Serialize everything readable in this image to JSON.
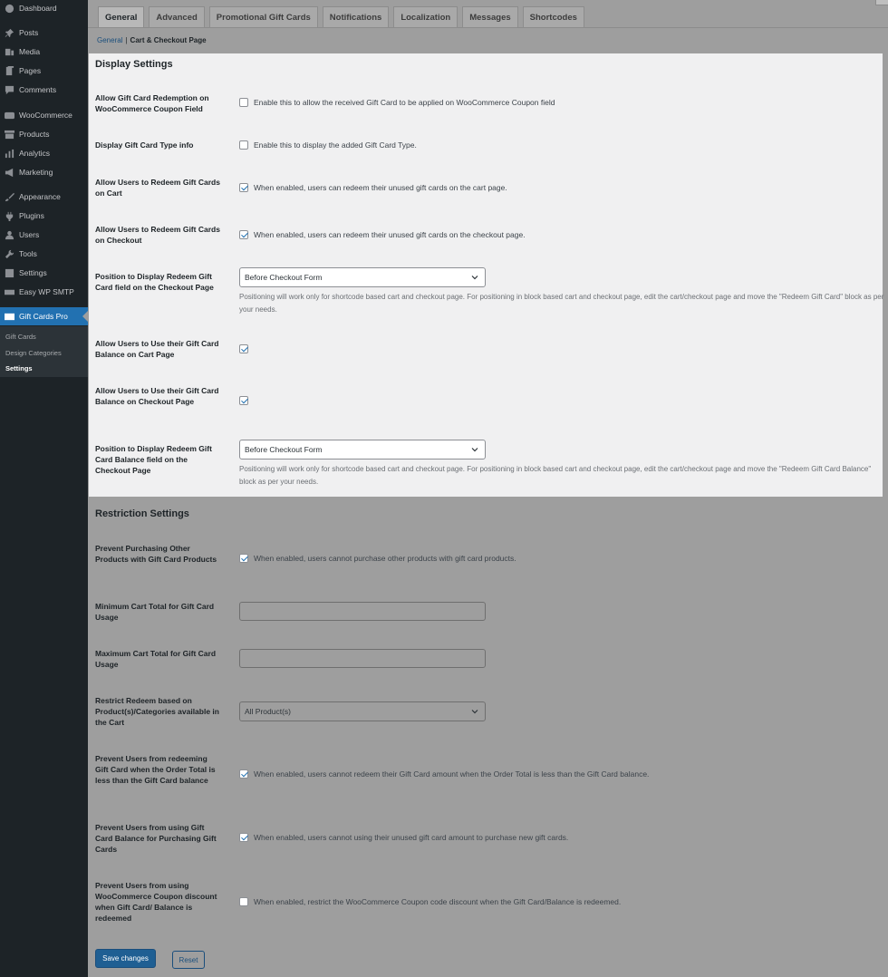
{
  "sidebar": {
    "menu": [
      {
        "label": "Dashboard",
        "icon": "dashboard-icon"
      },
      {
        "label": "Posts",
        "icon": "pin-icon"
      },
      {
        "label": "Media",
        "icon": "media-icon"
      },
      {
        "label": "Pages",
        "icon": "pages-icon"
      },
      {
        "label": "Comments",
        "icon": "comment-icon"
      },
      {
        "label": "WooCommerce",
        "icon": "woo-icon"
      },
      {
        "label": "Products",
        "icon": "archive-icon"
      },
      {
        "label": "Analytics",
        "icon": "bar-chart-icon"
      },
      {
        "label": "Marketing",
        "icon": "megaphone-icon"
      },
      {
        "label": "Appearance",
        "icon": "brush-icon"
      },
      {
        "label": "Plugins",
        "icon": "plug-icon"
      },
      {
        "label": "Users",
        "icon": "user-icon"
      },
      {
        "label": "Tools",
        "icon": "wrench-icon"
      },
      {
        "label": "Settings",
        "icon": "sliders-icon"
      },
      {
        "label": "Easy WP SMTP",
        "icon": "mail-icon"
      },
      {
        "label": "Gift Cards Pro",
        "icon": "gift-card-icon"
      }
    ],
    "submenu": [
      "Gift Cards",
      "Design Categories",
      "Settings"
    ]
  },
  "tabs": [
    "General",
    "Advanced",
    "Promotional Gift Cards",
    "Notifications",
    "Localization",
    "Messages",
    "Shortcodes"
  ],
  "breadcrumb": {
    "parent": "General",
    "current": "Cart & Checkout Page"
  },
  "display": {
    "title": "Display Settings",
    "rows": [
      {
        "label": "Allow Gift Card Redemption on WooCommerce Coupon Field",
        "desc": "Enable this to allow the received Gift Card to be applied on WooCommerce Coupon field",
        "checked": false
      },
      {
        "label": "Display Gift Card Type info",
        "desc": "Enable this to display the added Gift Card Type.",
        "checked": false
      },
      {
        "label": "Allow Users to Redeem Gift Cards on Cart",
        "desc": "When enabled, users can redeem their unused gift cards on the cart page.",
        "checked": true
      },
      {
        "label": "Allow Users to Redeem Gift Cards on Checkout",
        "desc": "When enabled, users can redeem their unused gift cards on the checkout page.",
        "checked": true
      },
      {
        "label": "Position to Display Redeem Gift Card field on the Checkout Page",
        "select": "Before Checkout Form",
        "help": "Positioning will work only for shortcode based cart and checkout page. For positioning in block based cart and checkout page, edit the cart/checkout page and move the \"Redeem Gift Card\" block as per your needs."
      },
      {
        "label": "Allow Users to Use their Gift Card Balance on Cart Page",
        "checked": true
      },
      {
        "label": "Allow Users to Use their Gift Card Balance on Checkout Page",
        "checked": true
      },
      {
        "label": "Position to Display Redeem Gift Card Balance field on the Checkout Page",
        "select": "Before Checkout Form",
        "help": "Positioning will work only for shortcode based cart and checkout page. For positioning in block based cart and checkout page, edit the cart/checkout page and move the \"Redeem Gift Card Balance\" block as per your needs."
      }
    ]
  },
  "restriction": {
    "title": "Restriction Settings",
    "rows": [
      {
        "label": "Prevent Purchasing Other Products with Gift Card Products",
        "desc": "When enabled, users cannot purchase other products with gift card products.",
        "checked": true
      },
      {
        "label": "Minimum Cart Total for Gift Card Usage",
        "value": ""
      },
      {
        "label": "Maximum Cart Total for Gift Card Usage",
        "value": ""
      },
      {
        "label": "Restrict Redeem based on Product(s)/Categories available in the Cart",
        "select": "All Product(s)"
      },
      {
        "label": "Prevent Users from redeeming Gift Card when the Order Total is less than the Gift Card balance",
        "desc": "When enabled, users cannot redeem their Gift Card amount when the Order Total is less than the Gift Card balance.",
        "checked": true
      },
      {
        "label": "Prevent Users from using Gift Card Balance for Purchasing Gift Cards",
        "desc": "When enabled, users cannot using their unused gift card amount to purchase new gift cards.",
        "checked": true
      },
      {
        "label": "Prevent Users from using WooCommerce Coupon discount when Gift Card/ Balance is redeemed",
        "desc": "When enabled, restrict the WooCommerce Coupon code discount when the Gift Card/Balance is redeemed.",
        "checked": false
      }
    ]
  },
  "actions": {
    "save": "Save changes",
    "reset": "Reset"
  },
  "colors": {
    "accent": "#2271b1",
    "sidebar": "#1d2327",
    "panel": "#f0f0f1",
    "overlay": "#9e9e9e"
  }
}
